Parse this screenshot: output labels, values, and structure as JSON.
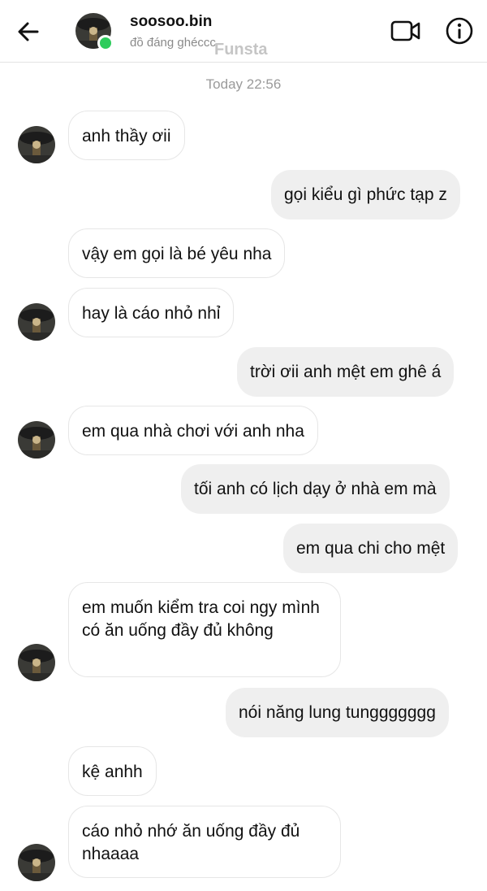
{
  "header": {
    "username": "soosoo.bin",
    "status": "đồ đáng ghéccc",
    "watermark": "Funsta",
    "back_icon": "arrow-left-icon",
    "video_icon": "video-call-icon",
    "info_icon": "info-icon",
    "online_color": "#2ecc5c"
  },
  "timestamp": "Today 22:56",
  "messages": [
    {
      "direction": "in",
      "text": "anh thầy ơii"
    },
    {
      "direction": "out",
      "text": "gọi kiểu gì phức tạp z"
    },
    {
      "direction": "in",
      "text": "vậy em gọi là bé yêu nha"
    },
    {
      "direction": "in",
      "text": "hay là cáo nhỏ nhỉ"
    },
    {
      "direction": "out",
      "text": "trời ơii anh mệt em ghê á"
    },
    {
      "direction": "in",
      "text": "em qua nhà chơi với anh nha"
    },
    {
      "direction": "out",
      "text": "tối anh có lịch dạy ở nhà em mà"
    },
    {
      "direction": "out",
      "text": "em qua chi cho mệt"
    },
    {
      "direction": "in",
      "text": "em muốn kiểm tra coi ngy mình có ăn uống đầy đủ không"
    },
    {
      "direction": "out",
      "text": "nói năng lung tunggggggg"
    },
    {
      "direction": "in",
      "text": "kệ anhh"
    },
    {
      "direction": "in",
      "text": "cáo nhỏ nhớ ăn uống đầy đủ nhaaaa"
    }
  ],
  "colors": {
    "incoming_bg": "#ffffff",
    "outgoing_bg": "#efefef",
    "timestamp": "#9a9a9a"
  }
}
